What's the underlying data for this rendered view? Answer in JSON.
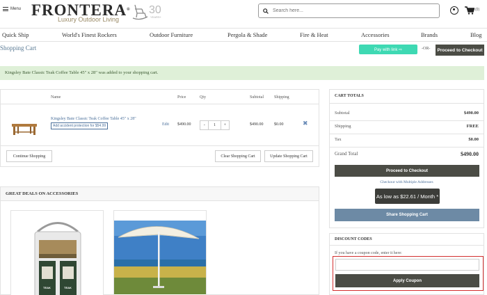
{
  "header": {
    "menu_label": "Menu",
    "logo_text": "FRONTERA",
    "logo_reg": "®",
    "logo_sub": "Luxury Outdoor Living",
    "anniv_number": "30",
    "anniv_sub": "YEARS+",
    "search_placeholder": "Search here...",
    "cart_count": "(0)"
  },
  "nav": [
    "Quick Ship",
    "World's Finest Rockers",
    "Outdoor Furniture",
    "Pergola & Shade",
    "Fire & Heat",
    "Accessories",
    "Brands",
    "Blog"
  ],
  "page": {
    "title": "Shopping Cart",
    "pay_with_link": "Pay with link ⇨",
    "or": "-OR-",
    "checkout_top": "Proceed to Checkout",
    "message": "Kingsley Bate Classic Teak Coffee Table 45\" x 28\" was added to your shopping cart."
  },
  "cart": {
    "headers": {
      "name": "Name",
      "price": "Price",
      "qty": "Qty",
      "subtotal": "Subtotal",
      "shipping": "Shipping"
    },
    "item": {
      "name": "Kingsley Bate Classic Teak Coffee Table 45\" x 28\"",
      "protection": "Add accident protection for $54.99",
      "edit": "Edit",
      "price": "$490.00",
      "qty": "1",
      "minus": "-",
      "plus": "+",
      "subtotal": "$490.00",
      "shipping": "$0.00",
      "remove": "✖"
    },
    "continue": "Continue Shopping",
    "clear": "Clear Shopping Cart",
    "update": "Update Shopping Cart"
  },
  "totals": {
    "heading": "CART TOTALS",
    "subtotal_label": "Subtotal",
    "subtotal_value": "$490.00",
    "shipping_label": "Shipping",
    "shipping_value": "FREE",
    "tax_label": "Tax",
    "tax_value": "$0.00",
    "grand_label": "Grand Total",
    "grand_value": "$490.00",
    "checkout": "Proceed to Checkout",
    "multi": "Checkout with Multiple Addresses",
    "afford": "As low as $22.61 / Month *",
    "share": "Share Shopping Cart"
  },
  "discount": {
    "heading": "DISCOUNT CODES",
    "hint": "If you have a coupon code, enter it here:",
    "input_value": "",
    "button": "Apply Coupon"
  },
  "deals": {
    "heading": "GREAT DEALS ON ACCESSORIES",
    "can_labels": [
      "TEAK",
      "TEAK"
    ]
  }
}
